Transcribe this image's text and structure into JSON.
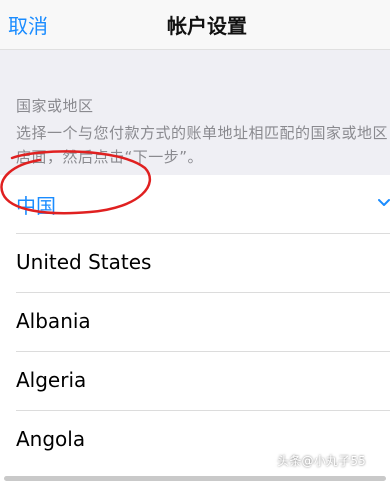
{
  "nav": {
    "cancel_label": "取消",
    "title": "帐户设置"
  },
  "section": {
    "title": "国家或地区",
    "description": "选择一个与您付款方式的账单地址相匹配的国家或地区店面，然后点击“下一步”。"
  },
  "countries": [
    {
      "label": "中国",
      "selected": true
    },
    {
      "label": "United States",
      "selected": false
    },
    {
      "label": "Albania",
      "selected": false
    },
    {
      "label": "Algeria",
      "selected": false
    },
    {
      "label": "Angola",
      "selected": false
    }
  ],
  "watermark": "头条@小丸子55",
  "colors": {
    "accent": "#1a8cff",
    "annotation": "#e02020",
    "section_bg": "#efeff4"
  }
}
